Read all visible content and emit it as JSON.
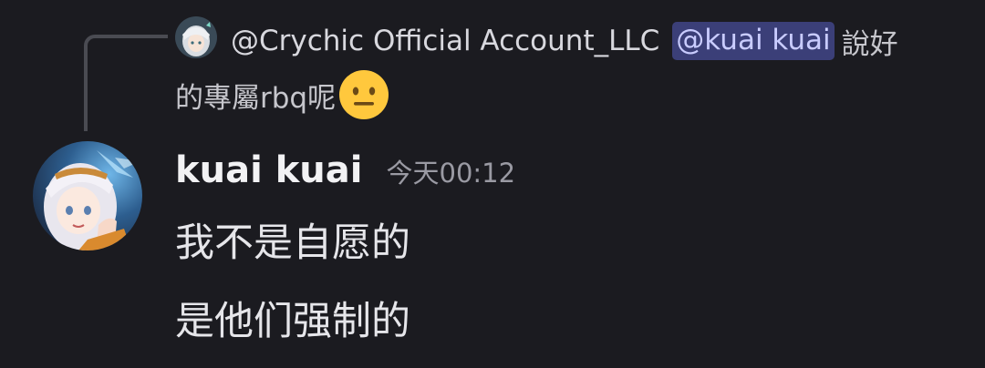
{
  "reply": {
    "author": "@Crychic Official Account_LLC",
    "mention": "@kuai kuai",
    "text_part1": "說好",
    "text_part2": "的專屬rbq呢",
    "emoji": "neutral-face-emoji",
    "avatar": "anime-girl-avatar-small"
  },
  "message": {
    "username": "kuai kuai",
    "timestamp": "今天00:12",
    "avatar": "anime-girl-avatar",
    "lines": [
      "我不是自愿的",
      "是他们强制的"
    ]
  },
  "colors": {
    "background": "#1b1b20",
    "mention_bg": "#3b3f78",
    "mention_text": "#c9ccff",
    "spine": "#4a4b52",
    "emoji_yellow": "#ffc83d"
  }
}
